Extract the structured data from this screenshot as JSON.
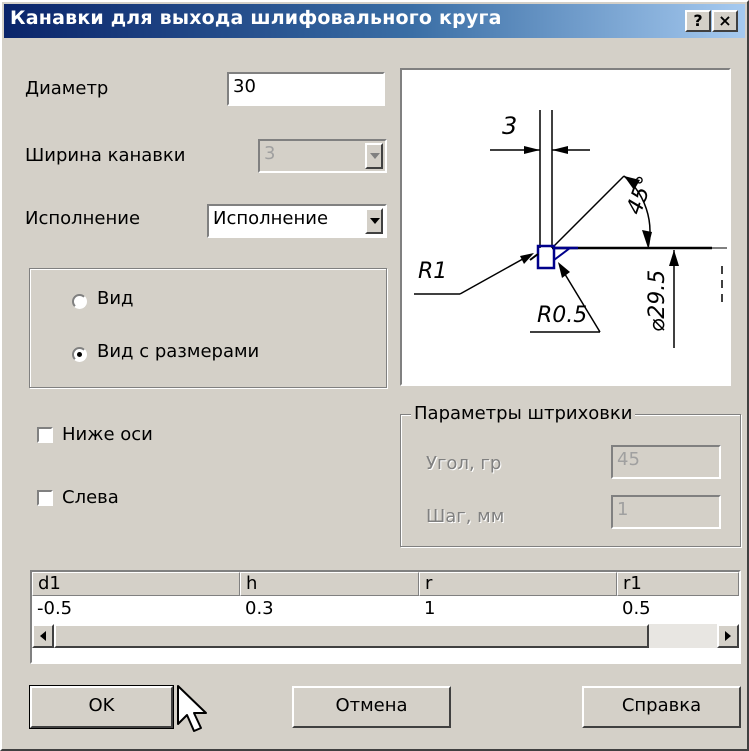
{
  "window": {
    "title": "Канавки для выхода шлифовального круга",
    "help_button": "?",
    "close_button": "×"
  },
  "form": {
    "diameter_label": "Диаметр",
    "diameter_value": "30",
    "groove_width_label": "Ширина канавки",
    "groove_width_value": "3",
    "execution_label": "Исполнение",
    "execution_value": "Исполнение"
  },
  "view_group": {
    "options": [
      {
        "label": "Вид",
        "selected": false
      },
      {
        "label": "Вид с размерами",
        "selected": true
      }
    ]
  },
  "checkboxes": {
    "below_axis_label": "Ниже оси",
    "below_axis_checked": false,
    "left_label": "Слева",
    "left_checked": false
  },
  "hatch": {
    "title": "Параметры штриховки",
    "angle_label": "Угол, гр",
    "angle_value": "45",
    "step_label": "Шаг, мм",
    "step_value": "1"
  },
  "preview": {
    "dim_width": "3",
    "dim_angle": "45°",
    "dim_r1": "R1",
    "dim_r05": "R0.5",
    "dim_diameter": "⌀29.5"
  },
  "table": {
    "headers": [
      "d1",
      "h",
      "r",
      "r1"
    ],
    "rows": [
      [
        "-0.5",
        "0.3",
        "1",
        "0.5"
      ]
    ]
  },
  "buttons": {
    "ok": "OK",
    "cancel": "Отмена",
    "help": "Справка"
  }
}
